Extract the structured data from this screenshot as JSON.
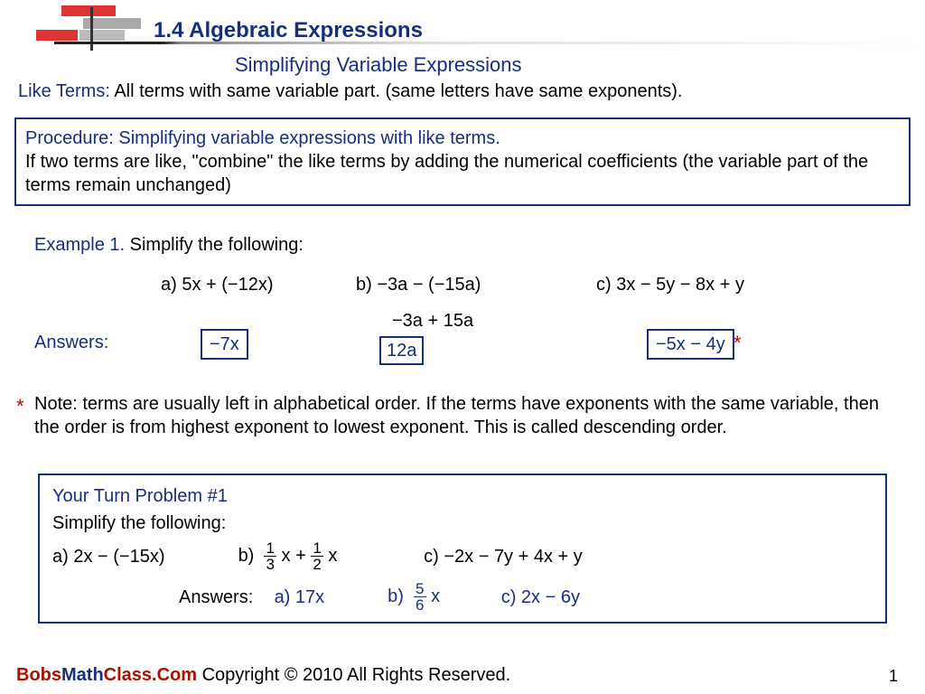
{
  "header": {
    "section": "1.4   Algebraic Expressions",
    "subtitle": "Simplifying Variable Expressions"
  },
  "like_terms": {
    "label": "Like Terms:",
    "text": "  All terms with same variable part.  (same letters have same exponents)."
  },
  "procedure": {
    "label": "Procedure:  ",
    "title": "Simplifying variable expressions with like terms.",
    "body": "If two terms are like, \"combine\" the like terms by adding the numerical coefficients (the variable part of the terms remain unchanged)"
  },
  "example1": {
    "label": "Example 1.",
    "instr": "  Simplify the following:",
    "a": "a)  5x + (−12x)",
    "b": "b)   −3a − (−15a)",
    "c": "c)  3x − 5y − 8x + y",
    "b_mid": "−3a + 15a",
    "answers_label": "Answers:",
    "ans_a": "−7x",
    "ans_b": "12a",
    "ans_c": "−5x − 4y"
  },
  "note": "Note: terms are usually left in alphabetical order.  If the terms have exponents with the same variable, then the order is from highest exponent to lowest exponent.  This is called descending order.",
  "ytp": {
    "title": "Your Turn Problem #1",
    "instr": "Simplify the following:",
    "a_label": "a)  2x − (−15x)",
    "b_label": "b)",
    "b_frac1_n": "1",
    "b_frac1_d": "3",
    "b_mid": " x + ",
    "b_frac2_n": "1",
    "b_frac2_d": "2",
    "b_tail": " x",
    "c_label": "c)   −2x − 7y + 4x + y",
    "answers_label": "Answers:",
    "ans_a": "a)  17x",
    "ans_b_label": "b)",
    "ans_b_n": "5",
    "ans_b_d": "6",
    "ans_b_tail": " x",
    "ans_c": "c)  2x − 6y"
  },
  "footer": {
    "bobs": "Bobs",
    "math": "Math",
    "class": "Class.Com",
    "copy": "  Copyright © 2010  All Rights Reserved."
  },
  "page": "1"
}
